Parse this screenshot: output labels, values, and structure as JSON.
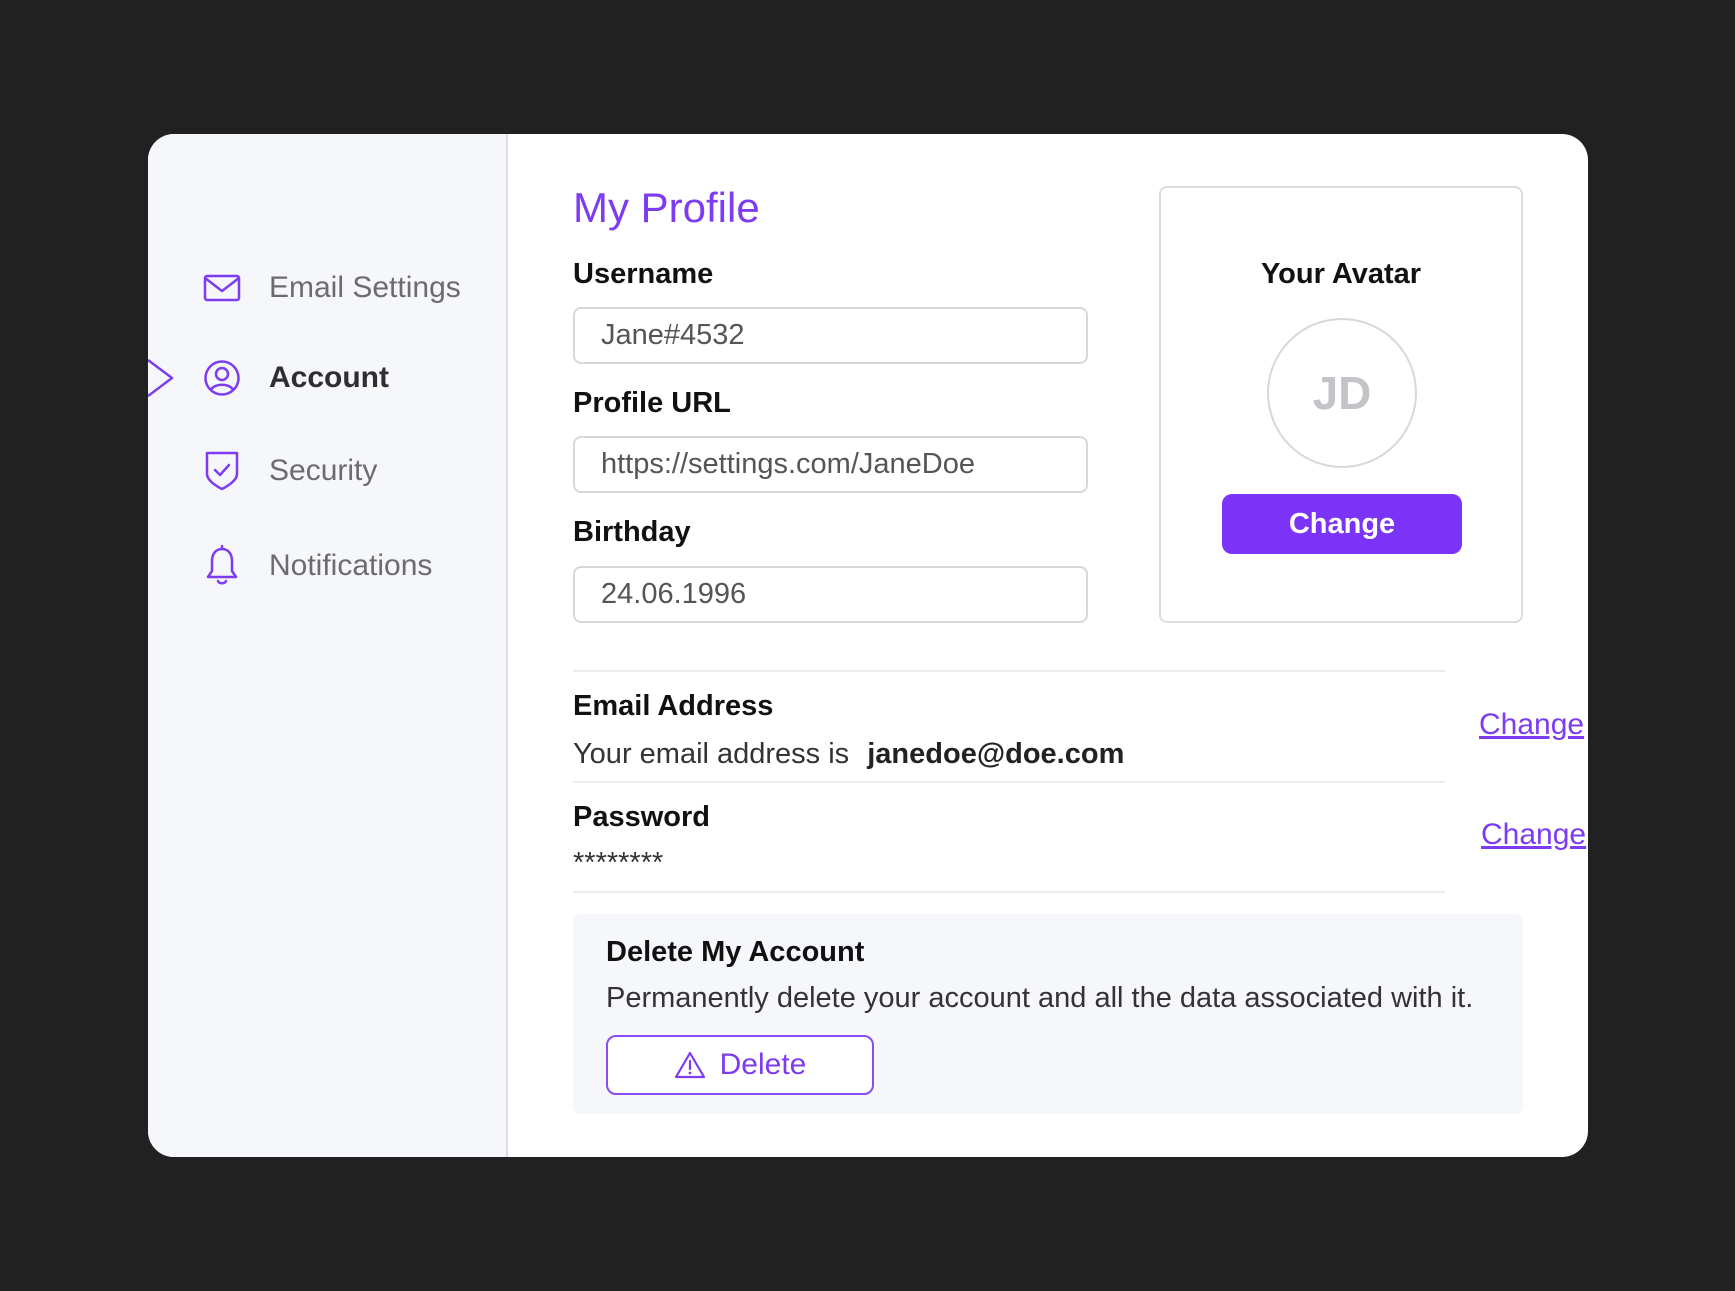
{
  "sidebar": {
    "items": [
      {
        "label": "Email Settings",
        "icon": "envelope-icon"
      },
      {
        "label": "Account",
        "icon": "user-circle-icon",
        "active": true
      },
      {
        "label": "Security",
        "icon": "shield-check-icon"
      },
      {
        "label": "Notifications",
        "icon": "bell-icon"
      }
    ]
  },
  "profile": {
    "title": "My Profile",
    "username_label": "Username",
    "username_value": "Jane#4532",
    "url_label": "Profile URL",
    "url_value": "https://settings.com/JaneDoe",
    "birthday_label": "Birthday",
    "birthday_value": "24.06.1996"
  },
  "avatar": {
    "title": "Your Avatar",
    "initials": "JD",
    "button_label": "Change"
  },
  "email": {
    "title": "Email Address",
    "text": "Your email address is",
    "address": "janedoe@doe.com",
    "link_label": "Change"
  },
  "password": {
    "title": "Password",
    "masked": "********",
    "link_label": "Change"
  },
  "delete_account": {
    "title": "Delete My Account",
    "description": "Permanently delete your account and all the data associated with it.",
    "button_label": "Delete"
  },
  "colors": {
    "accent": "#7b33f7",
    "background": "#212121",
    "sidebar": "#f6f7fb"
  }
}
